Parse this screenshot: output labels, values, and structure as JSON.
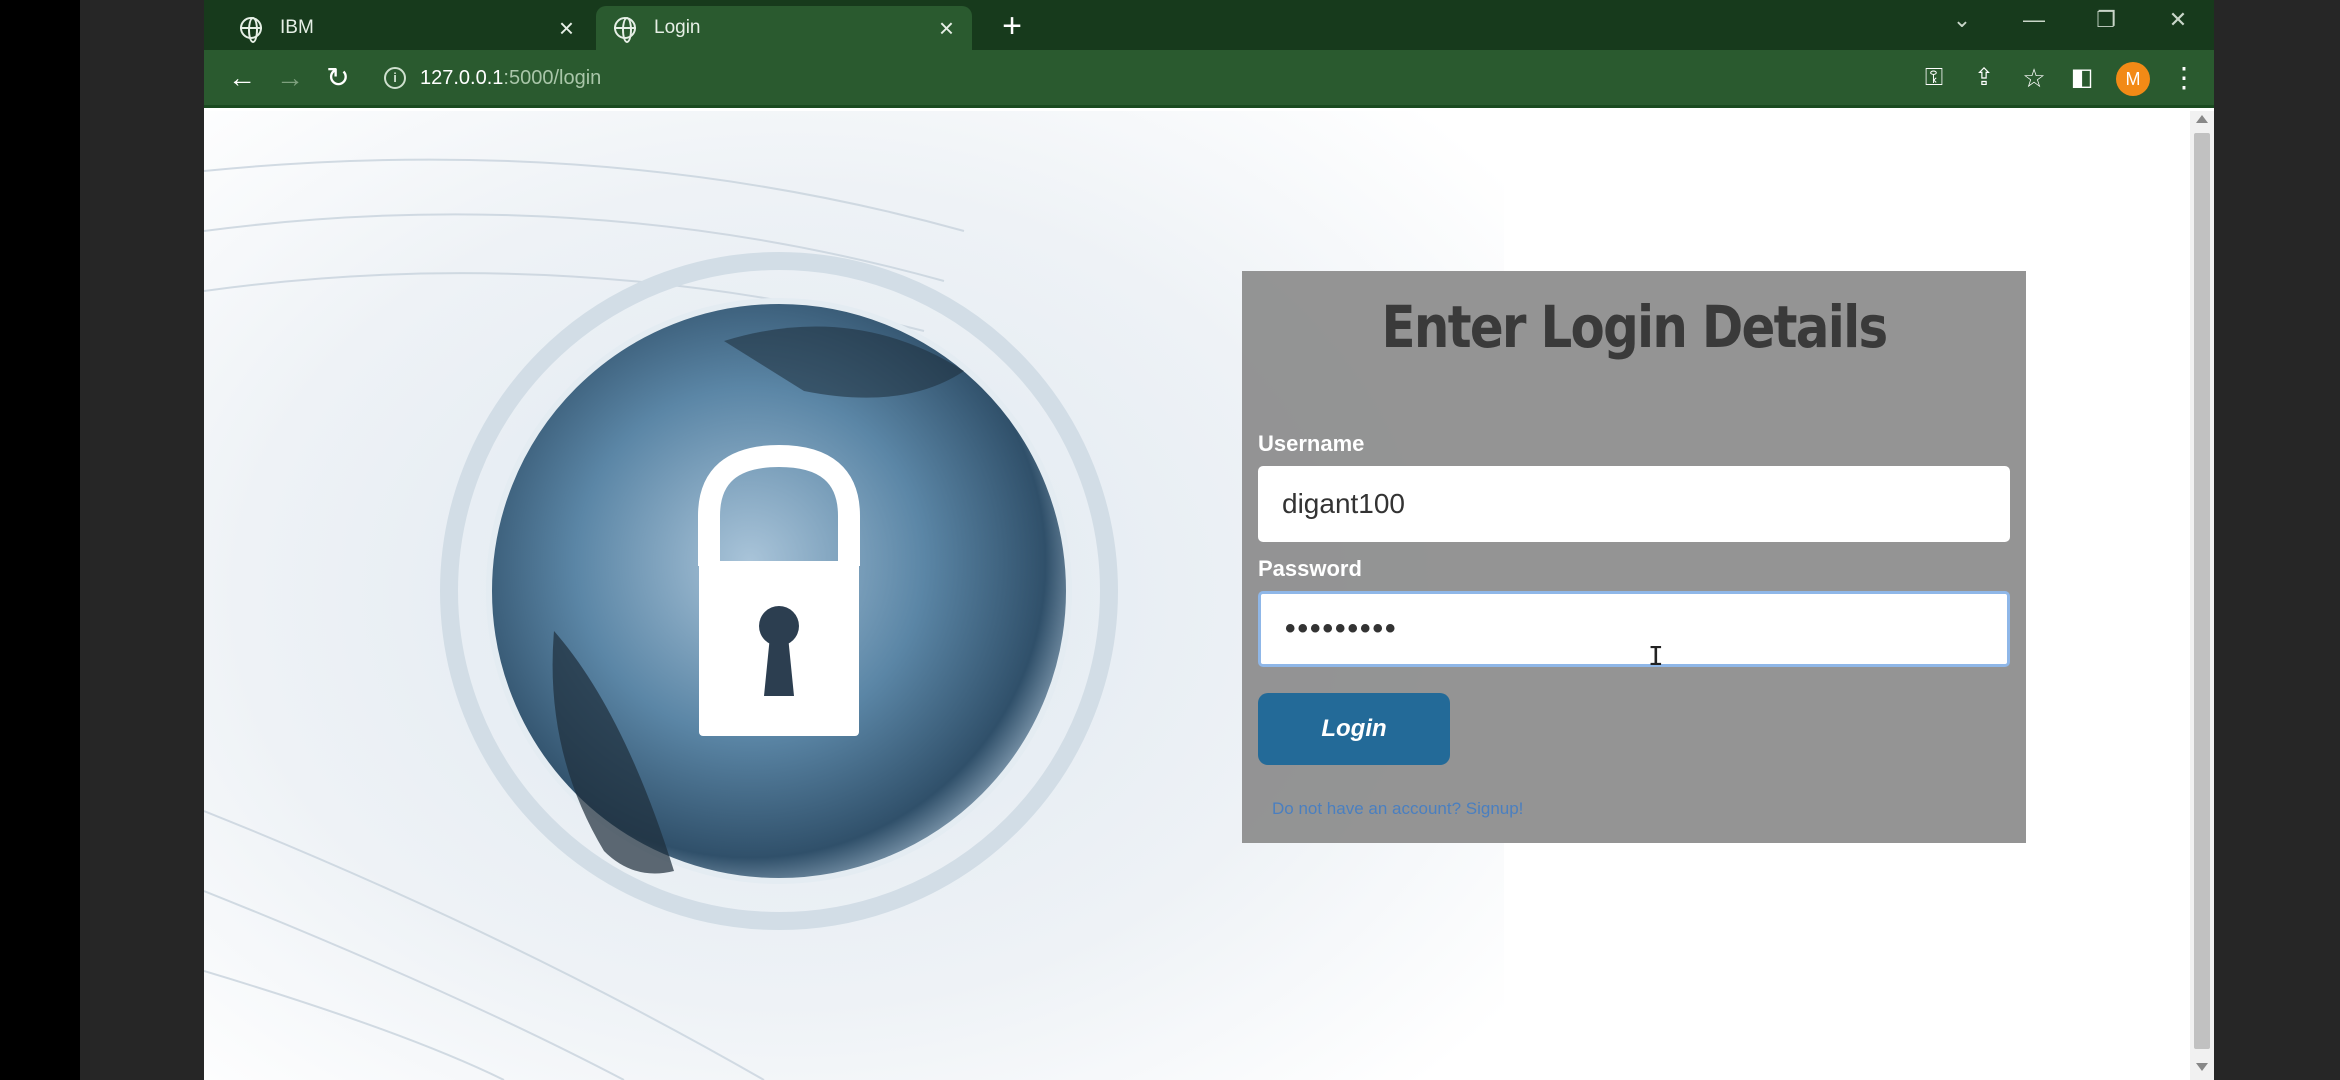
{
  "browser": {
    "tabs": [
      {
        "label": "IBM",
        "active": false
      },
      {
        "label": "Login",
        "active": true
      }
    ],
    "url_host": "127.0.0.1",
    "url_path": ":5000/login",
    "profile_initial": "M",
    "window_controls": {
      "dropdown": "⌄",
      "minimize": "—",
      "restore": "❐",
      "close": "✕"
    }
  },
  "login": {
    "title": "Enter Login Details",
    "username_label": "Username",
    "username_value": "digant100",
    "password_label": "Password",
    "password_value": "•••••••••",
    "button_label": "Login",
    "signup_text": "Do not have an account? Signup!"
  },
  "colors": {
    "tab_strip": "#173a1c",
    "toolbar": "#2a5a2f",
    "card": "#8c8c8c",
    "button": "#236a98",
    "link": "#4a7fc0"
  }
}
